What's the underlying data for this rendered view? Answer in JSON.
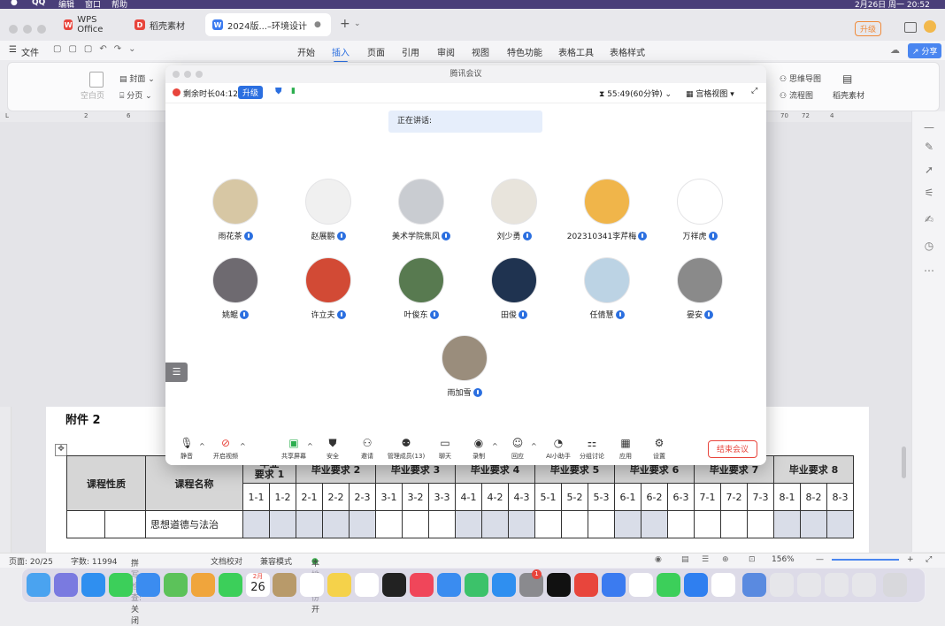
{
  "menubar": {
    "app": "QQ",
    "items": [
      "编辑",
      "窗口",
      "帮助"
    ],
    "date_time": "2月26日 周一 20:52"
  },
  "wps": {
    "tabs": [
      {
        "label": "WPS Office"
      },
      {
        "label": "稻壳素材"
      },
      {
        "label": "2024版...–环境设计"
      }
    ],
    "upgrade": "升级",
    "share": "分享",
    "file_menu": "文件",
    "ribbon_tabs": [
      "开始",
      "插入",
      "页面",
      "引用",
      "审阅",
      "视图",
      "特色功能",
      "表格工具",
      "表格样式"
    ],
    "ribbon_left": [
      "封面",
      "空白页",
      "分页"
    ],
    "ribbon_right": [
      "思维导图",
      "流程图",
      "稻壳素材"
    ],
    "ruler_left": [
      "2",
      "6"
    ],
    "ruler_right": [
      "70",
      "72",
      "4"
    ]
  },
  "doc": {
    "heading": "附件 2",
    "table": {
      "col1": "课程性质",
      "col2": "课程名称",
      "reqs": [
        "毕业要求 1",
        "毕业要求 2",
        "毕业要求 3",
        "毕业要求 4",
        "毕业要求 5",
        "毕业要求 6",
        "毕业要求 7",
        "毕业要求 8"
      ],
      "req1_lines": [
        "毕业",
        "要求 1"
      ],
      "subs": [
        "1-1",
        "1-2",
        "2-1",
        "2-2",
        "2-3",
        "3-1",
        "3-2",
        "3-3",
        "4-1",
        "4-2",
        "4-3",
        "5-1",
        "5-2",
        "5-3",
        "6-1",
        "6-2",
        "6-3",
        "7-1",
        "7-2",
        "7-3",
        "8-1",
        "8-2",
        "8-3"
      ],
      "row1_course": "思想道德与法治"
    }
  },
  "status": {
    "page": "页面: 20/25",
    "words": "字数: 11994",
    "spell": "拼写检查: 关闭",
    "proof": "文档校对",
    "compat": "兼容模式",
    "backup": "本地备份开",
    "zoom": "156%"
  },
  "meeting": {
    "title": "腾讯会议",
    "remaining": "剩余时长04:12",
    "upgrade": "升级",
    "duration": "55:49(60分钟)",
    "view": "宫格视图",
    "speaking": "正在讲话:",
    "participants": [
      {
        "name": "雨花茶",
        "color": "#d7c7a4"
      },
      {
        "name": "赵展鹏",
        "color": "#f0f0f0"
      },
      {
        "name": "美术学院焦凤",
        "color": "#c9ccd1"
      },
      {
        "name": "刘少勇",
        "color": "#e8e4dc"
      },
      {
        "name": "202310341李芹梅",
        "color": "#f0b54a"
      },
      {
        "name": "万祥虎",
        "color": "#ffffff"
      },
      {
        "name": "姚鲲",
        "color": "#6e6a70"
      },
      {
        "name": "许立夫",
        "color": "#d24a35"
      },
      {
        "name": "叶俊东",
        "color": "#587a50"
      },
      {
        "name": "田俊",
        "color": "#1f3350"
      },
      {
        "name": "任倩慧",
        "color": "#bcd3e4"
      },
      {
        "name": "晏安",
        "color": "#8a8a8a"
      },
      {
        "name": "雨加雪",
        "color": "#9a8d7c"
      }
    ],
    "toolbar": [
      "静音",
      "开启视频",
      "共享屏幕",
      "安全",
      "邀请",
      "管理成员(13)",
      "聊天",
      "录制",
      "回应",
      "AI小助手",
      "分组讨论",
      "应用",
      "设置"
    ],
    "end": "结束会议"
  },
  "dock": {
    "date_day": "26",
    "date_month": "2月",
    "badge": "1"
  }
}
